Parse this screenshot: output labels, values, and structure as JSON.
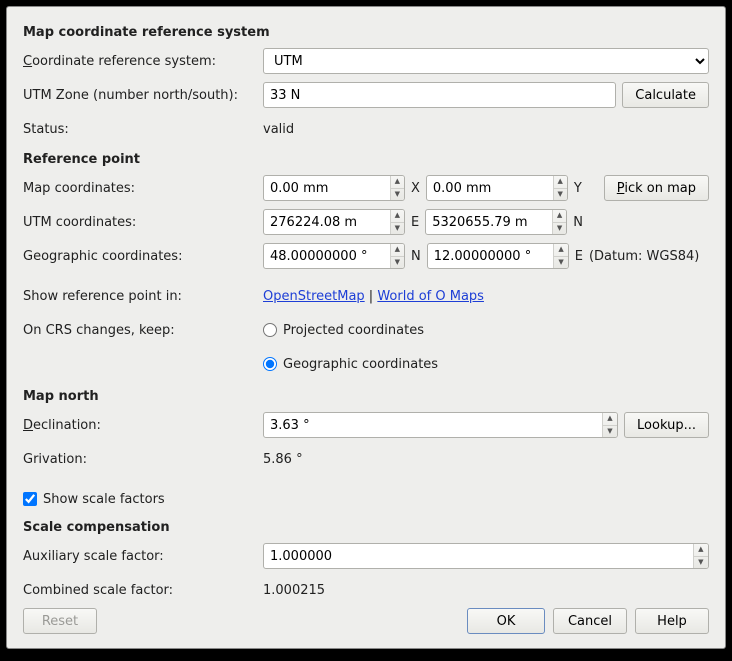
{
  "section_crs": {
    "title": "Map coordinate reference system",
    "crs_label": "Coordinate reference system:",
    "crs_value": "UTM",
    "zone_label": "UTM Zone (number north/south):",
    "zone_value": "33 N",
    "calc_label": "Calculate",
    "status_label": "Status:",
    "status_value": "valid"
  },
  "section_ref": {
    "title": "Reference point",
    "map_label": "Map coordinates:",
    "map_x": "0.00 mm",
    "map_y": "0.00 mm",
    "x_suffix": "X",
    "y_suffix": "Y",
    "pick_label": "Pick on map",
    "utm_label": "UTM coordinates:",
    "utm_e": "276224.08 m",
    "utm_n": "5320655.79 m",
    "e_suffix": "E",
    "n_suffix": "N",
    "geo_label": "Geographic coordinates:",
    "geo_lat": "48.00000000 °",
    "geo_lon": "12.00000000 °",
    "datum_text": "(Datum: WGS84)",
    "show_label": "Show reference point in:",
    "link_osm": "OpenStreetMap",
    "link_sep": " | ",
    "link_woo": "World of O Maps",
    "keep_label": "On CRS changes, keep:",
    "radio_proj": "Projected coordinates",
    "radio_geo": "Geographic coordinates"
  },
  "section_north": {
    "title": "Map north",
    "decl_label": "Declination:",
    "decl_value": "3.63 °",
    "lookup_label": "Lookup...",
    "griv_label": "Grivation:",
    "griv_value": "5.86 °"
  },
  "section_scale": {
    "checkbox_label": "Show scale factors",
    "title": "Scale compensation",
    "aux_label": "Auxiliary scale factor:",
    "aux_value": "1.000000",
    "comb_label": "Combined scale factor:",
    "comb_value": "1.000215"
  },
  "buttons": {
    "reset": "Reset",
    "ok": "OK",
    "cancel": "Cancel",
    "help": "Help"
  }
}
